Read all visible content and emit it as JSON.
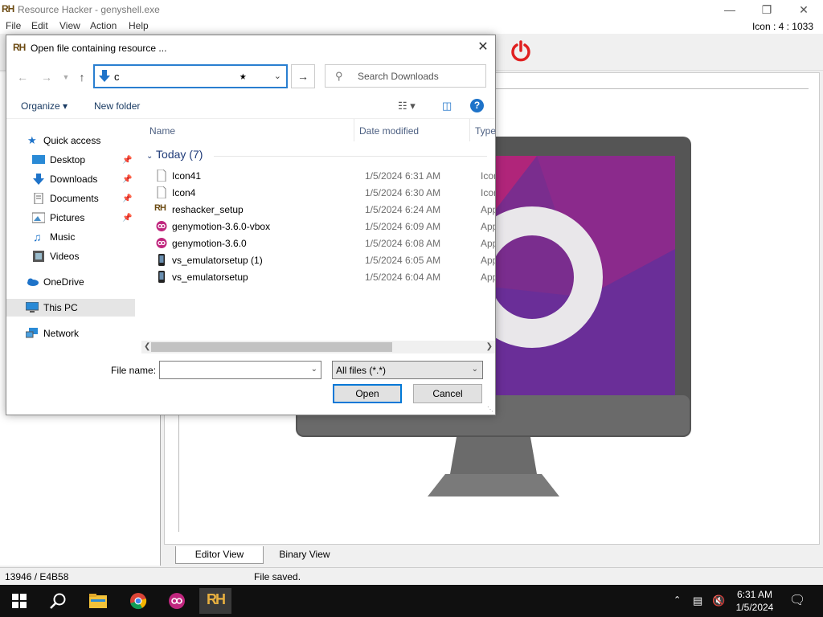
{
  "app": {
    "title": "Resource Hacker - genyshell.exe",
    "logo": "RH",
    "menu": [
      "File",
      "Edit",
      "View",
      "Action",
      "Help"
    ],
    "icon_info": "Icon : 4 : 1033",
    "tabs": [
      "Editor View",
      "Binary View"
    ],
    "status_left": "13946 / E4B58",
    "status_right": "File saved."
  },
  "dialog": {
    "title": "Open file containing resource ...",
    "address_text": "c",
    "search_placeholder": "Search Downloads",
    "organize_label": "Organize",
    "new_folder_label": "New folder",
    "nav": [
      {
        "label": "Quick access",
        "icon": "star-icon"
      },
      {
        "label": "Desktop",
        "icon": "desktop-folder-icon",
        "pinned": true
      },
      {
        "label": "Downloads",
        "icon": "download-arrow-icon",
        "pinned": true
      },
      {
        "label": "Documents",
        "icon": "document-icon",
        "pinned": true
      },
      {
        "label": "Pictures",
        "icon": "picture-icon",
        "pinned": true
      },
      {
        "label": "Music",
        "icon": "music-note-icon"
      },
      {
        "label": "Videos",
        "icon": "film-icon"
      },
      {
        "label": "OneDrive",
        "icon": "cloud-icon"
      },
      {
        "label": "This PC",
        "icon": "computer-icon",
        "selected": true
      },
      {
        "label": "Network",
        "icon": "network-icon"
      }
    ],
    "columns": {
      "name": "Name",
      "date": "Date modified",
      "type": "Type"
    },
    "group": "Today (7)",
    "files": [
      {
        "name": "Icon41",
        "date": "1/5/2024 6:31 AM",
        "type": "Icon",
        "icon": "blank-file-icon"
      },
      {
        "name": "Icon4",
        "date": "1/5/2024 6:30 AM",
        "type": "Icon",
        "icon": "blank-file-icon"
      },
      {
        "name": "reshacker_setup",
        "date": "1/5/2024 6:24 AM",
        "type": "Appli",
        "icon": "reshacker-app-icon"
      },
      {
        "name": "genymotion-3.6.0-vbox",
        "date": "1/5/2024 6:09 AM",
        "type": "Appli",
        "icon": "genymotion-app-icon"
      },
      {
        "name": "genymotion-3.6.0",
        "date": "1/5/2024 6:08 AM",
        "type": "Appli",
        "icon": "genymotion-app-icon"
      },
      {
        "name": "vs_emulatorsetup (1)",
        "date": "1/5/2024 6:05 AM",
        "type": "Appli",
        "icon": "installer-app-icon"
      },
      {
        "name": "vs_emulatorsetup",
        "date": "1/5/2024 6:04 AM",
        "type": "Appli",
        "icon": "installer-app-icon"
      }
    ],
    "file_name_label": "File name:",
    "file_name_value": "",
    "filter_value": "All files (*.*)",
    "open_label": "Open",
    "cancel_label": "Cancel"
  },
  "taskbar": {
    "time": "6:31 AM",
    "date": "1/5/2024",
    "apps": [
      "windows-start-icon",
      "search-icon",
      "file-explorer-icon",
      "chrome-icon",
      "genymotion-icon",
      "resource-hacker-icon"
    ]
  },
  "colors": {
    "accent": "#0078d7",
    "power": "#e02020",
    "taskbar": "#101010"
  }
}
